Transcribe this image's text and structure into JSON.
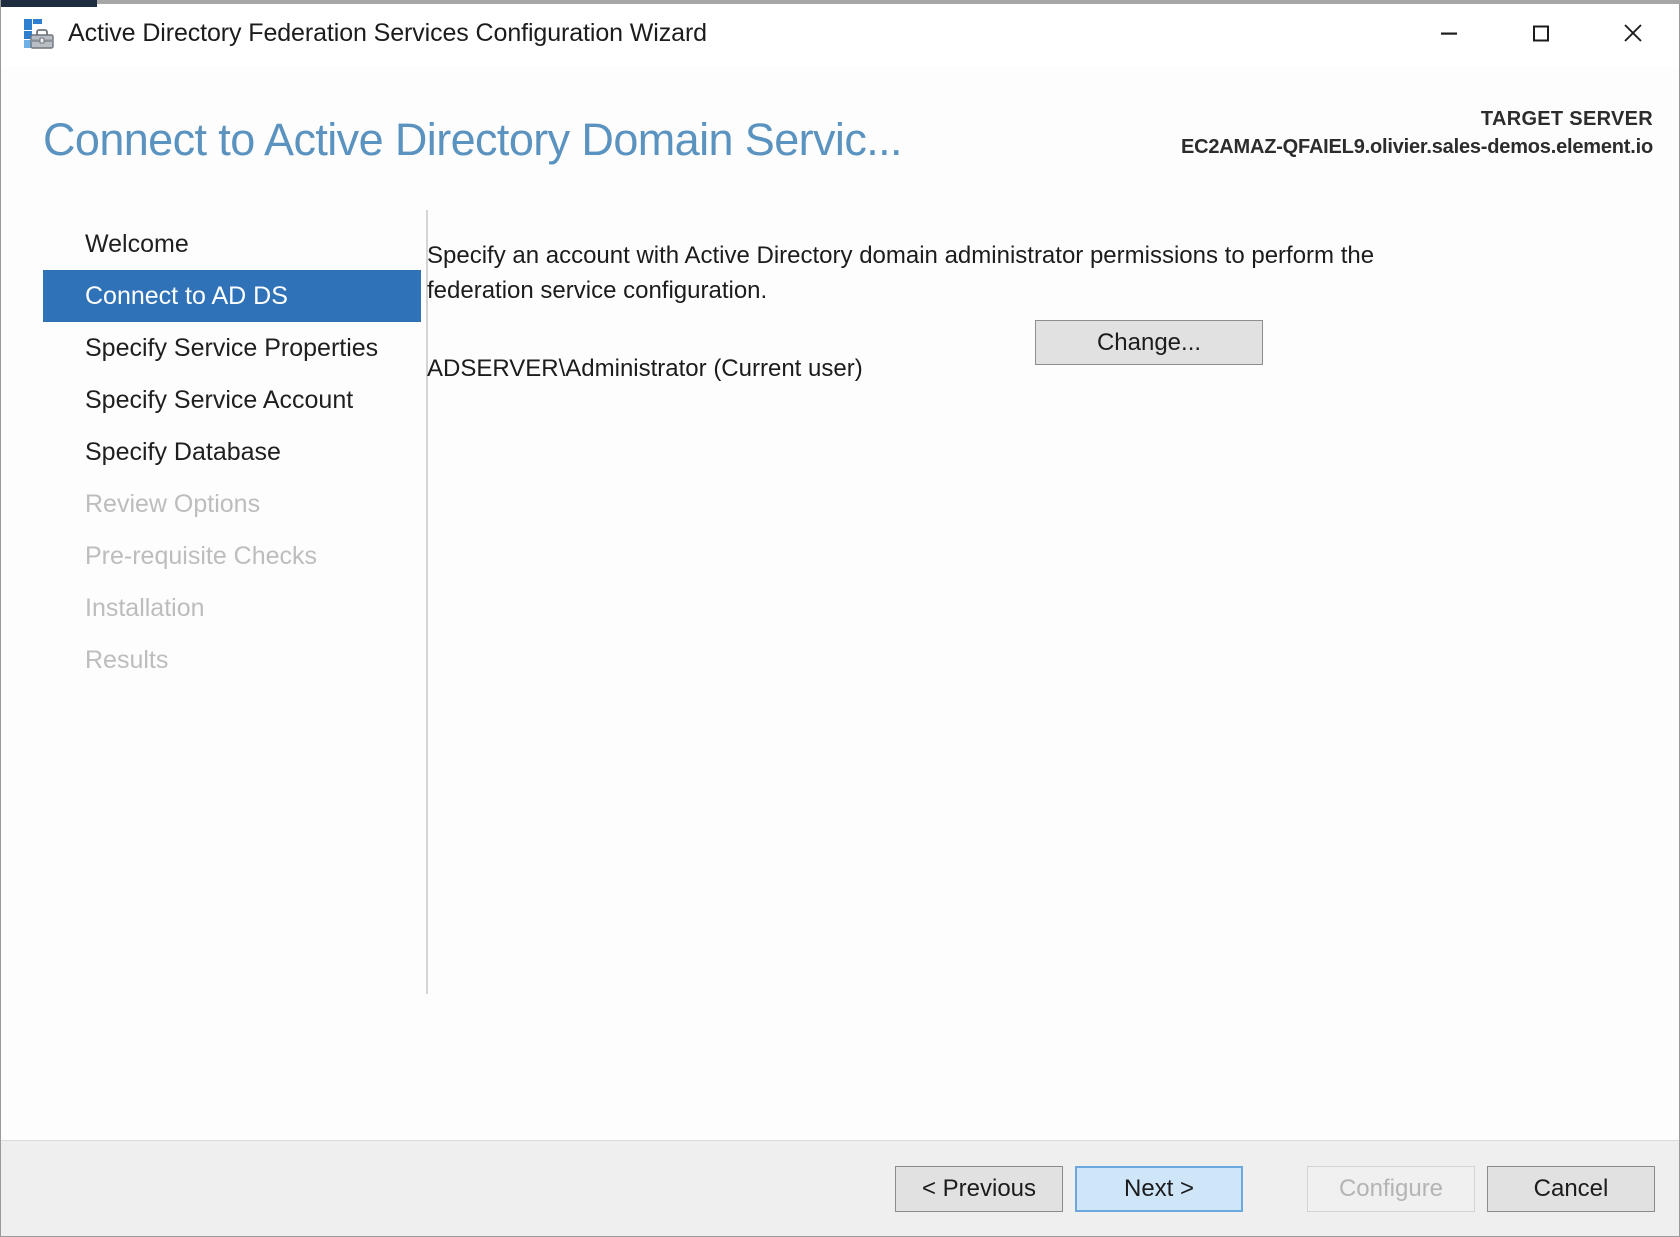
{
  "window": {
    "title": "Active Directory Federation Services Configuration Wizard",
    "app_icon": "adfs-wizard-icon",
    "controls": {
      "minimize": "minimize-icon",
      "maximize": "maximize-icon",
      "close": "close-icon"
    }
  },
  "header": {
    "page_title": "Connect to Active Directory Domain Servic...",
    "target_server_label": "TARGET SERVER",
    "target_server_name": "EC2AMAZ-QFAIEL9.olivier.sales-demos.element.io"
  },
  "sidebar": {
    "items": [
      {
        "label": "Welcome",
        "state": "enabled"
      },
      {
        "label": "Connect to AD DS",
        "state": "selected"
      },
      {
        "label": "Specify Service Properties",
        "state": "enabled"
      },
      {
        "label": "Specify Service Account",
        "state": "enabled"
      },
      {
        "label": "Specify Database",
        "state": "enabled"
      },
      {
        "label": "Review Options",
        "state": "disabled"
      },
      {
        "label": "Pre-requisite Checks",
        "state": "disabled"
      },
      {
        "label": "Installation",
        "state": "disabled"
      },
      {
        "label": "Results",
        "state": "disabled"
      }
    ]
  },
  "content": {
    "instruction": "Specify an account with Active Directory domain administrator permissions to perform the federation service configuration.",
    "account_name": "ADSERVER\\Administrator (Current user)",
    "change_button": "Change..."
  },
  "footer": {
    "previous": "< Previous",
    "next": "Next >",
    "configure": "Configure",
    "cancel": "Cancel"
  },
  "colors": {
    "selection_blue": "#2f72b8",
    "title_blue": "#5b93c0",
    "default_button_blue": "#cfe6f9",
    "accent_navy": "#1e2d3f"
  }
}
